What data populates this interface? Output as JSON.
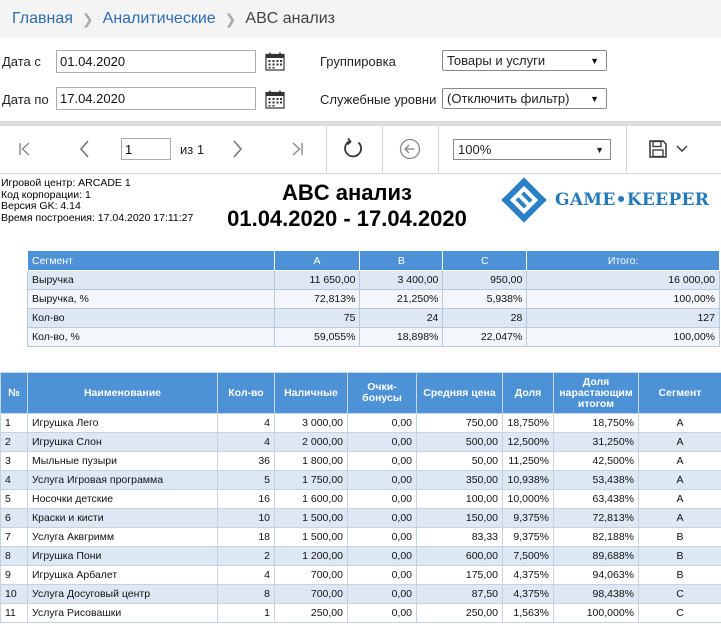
{
  "breadcrumb": {
    "home": "Главная",
    "section": "Аналитические",
    "current": "ABC анализ"
  },
  "filters": {
    "date_from_label": "Дата с",
    "date_from_value": "01.04.2020",
    "date_to_label": "Дата по",
    "date_to_value": "17.04.2020",
    "grouping_label": "Группировка",
    "grouping_value": "Товары и услуги",
    "service_levels_label": "Служебные уровни",
    "service_levels_value": "(Отключить фильтр)"
  },
  "toolbar": {
    "page_value": "1",
    "page_of": "из 1",
    "zoom_value": "100%"
  },
  "report": {
    "meta": [
      "Игровой центр: ARCADE 1",
      "Код корпорации: 1",
      "Версия GK: 4.14",
      "Время построения: 17.04.2020 17:11:27"
    ],
    "title": "ABC анализ",
    "dates": "01.04.2020 - 17.04.2020",
    "logo_text": "GAME•KEEPER",
    "segment_table": {
      "headers": [
        "Сегмент",
        "A",
        "B",
        "C",
        "Итого:"
      ],
      "rows": [
        [
          "Выручка",
          "11 650,00",
          "3 400,00",
          "950,00",
          "16 000,00"
        ],
        [
          "Выручка, %",
          "72,813%",
          "21,250%",
          "5,938%",
          "100,00%"
        ],
        [
          "Кол-во",
          "75",
          "24",
          "28",
          "127"
        ],
        [
          "Кол-во, %",
          "59,055%",
          "18,898%",
          "22,047%",
          "100,00%"
        ]
      ]
    },
    "main_table": {
      "headers": [
        "№",
        "Наименование",
        "Кол-во",
        "Наличные",
        "Очки-бонусы",
        "Средняя цена",
        "Доля",
        "Доля нарастающим итогом",
        "Сегмент"
      ],
      "rows": [
        [
          "1",
          "Игрушка Лего",
          "4",
          "3 000,00",
          "0,00",
          "750,00",
          "18,750%",
          "18,750%",
          "A"
        ],
        [
          "2",
          "Игрушка Слон",
          "4",
          "2 000,00",
          "0,00",
          "500,00",
          "12,500%",
          "31,250%",
          "A"
        ],
        [
          "3",
          "Мыльные пузыри",
          "36",
          "1 800,00",
          "0,00",
          "50,00",
          "11,250%",
          "42,500%",
          "A"
        ],
        [
          "4",
          "Услуга Игровая программа",
          "5",
          "1 750,00",
          "0,00",
          "350,00",
          "10,938%",
          "53,438%",
          "A"
        ],
        [
          "5",
          "Носочки детские",
          "16",
          "1 600,00",
          "0,00",
          "100,00",
          "10,000%",
          "63,438%",
          "A"
        ],
        [
          "6",
          "Краски и кисти",
          "10",
          "1 500,00",
          "0,00",
          "150,00",
          "9,375%",
          "72,813%",
          "A"
        ],
        [
          "7",
          "Услуга Аквгримм",
          "18",
          "1 500,00",
          "0,00",
          "83,33",
          "9,375%",
          "82,188%",
          "B"
        ],
        [
          "8",
          "Игрушка Пони",
          "2",
          "1 200,00",
          "0,00",
          "600,00",
          "7,500%",
          "89,688%",
          "B"
        ],
        [
          "9",
          "Игрушка Арбалет",
          "4",
          "700,00",
          "0,00",
          "175,00",
          "4,375%",
          "94,063%",
          "B"
        ],
        [
          "10",
          "Услуга Досуговый центр",
          "8",
          "700,00",
          "0,00",
          "87,50",
          "4,375%",
          "98,438%",
          "C"
        ],
        [
          "11",
          "Услуга Рисовашки",
          "1",
          "250,00",
          "0,00",
          "250,00",
          "1,563%",
          "100,000%",
          "C"
        ]
      ]
    }
  },
  "colors": {
    "accent": "#2b6cb0",
    "table_header": "#4d91d6",
    "row_stripe": "#dde8f4",
    "logo": "#2479b8"
  },
  "icons": {
    "calendar": "calendar-icon",
    "first_page": "first-page-icon",
    "prev_page": "prev-page-icon",
    "next_page": "next-page-icon",
    "last_page": "last-page-icon",
    "refresh": "refresh-icon",
    "back": "back-icon",
    "save": "save-icon"
  }
}
